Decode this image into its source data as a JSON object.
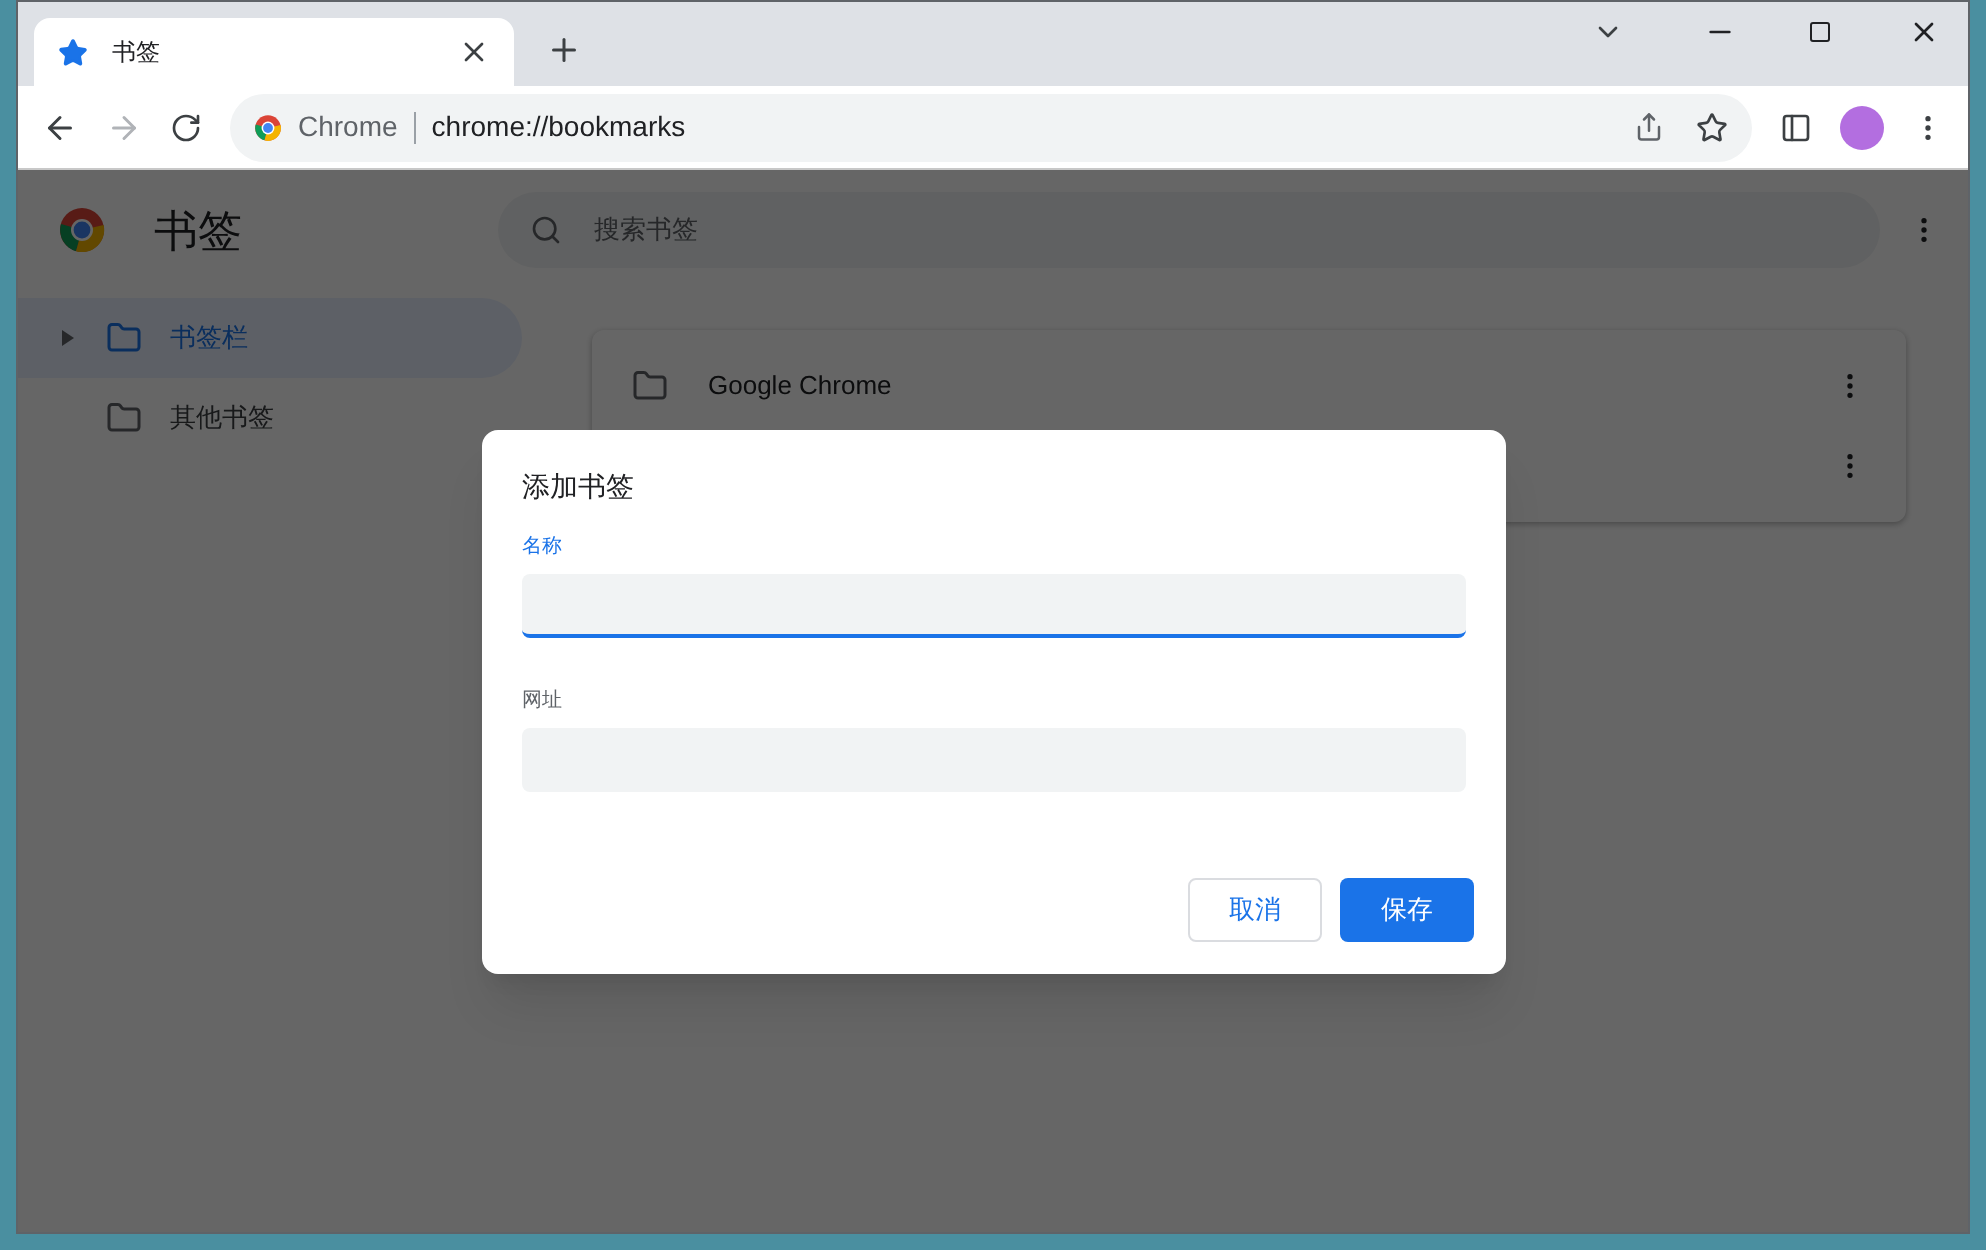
{
  "window": {
    "tab": {
      "title": "书签",
      "selected": true
    },
    "address_bar": {
      "site_label": "Chrome",
      "url": "chrome://bookmarks"
    }
  },
  "page": {
    "title": "书签",
    "search": {
      "placeholder": "搜索书签"
    },
    "sidebar": {
      "items": [
        {
          "label": "书签栏",
          "selected": true,
          "expandable": true
        },
        {
          "label": "其他书签",
          "selected": false,
          "expandable": false
        }
      ]
    },
    "list": {
      "rows": [
        {
          "kind": "folder",
          "label": "Google Chrome"
        },
        {
          "kind": "covered"
        }
      ]
    }
  },
  "dialog": {
    "title": "添加书签",
    "fields": [
      {
        "label": "名称",
        "focused": true
      },
      {
        "label": "网址",
        "focused": false
      }
    ],
    "buttons": [
      {
        "label": "取消",
        "kind": "secondary"
      },
      {
        "label": "保存",
        "kind": "primary"
      }
    ]
  }
}
